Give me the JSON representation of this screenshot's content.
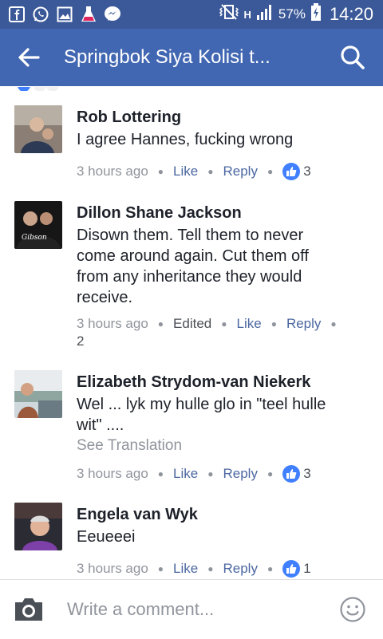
{
  "status_bar": {
    "battery": "57%",
    "time": "14:20",
    "network": "H"
  },
  "app_bar": {
    "title": "Springbok Siya Kolisi t..."
  },
  "comments": [
    {
      "author": "Rob Lottering",
      "lines": [
        "I agree Hannes, fucking wrong"
      ],
      "time": "3 hours ago",
      "like_label": "Like",
      "reply_label": "Reply",
      "reactions": "3"
    },
    {
      "author": "Dillon Shane Jackson",
      "lines": [
        "Disown them. Tell them to never",
        "come around again. Cut them off",
        "from any inheritance they would",
        "receive."
      ],
      "time": "3 hours ago",
      "edited_label": "Edited",
      "like_label": "Like",
      "reply_label": "Reply",
      "reactions": "2"
    },
    {
      "author": "Elizabeth Strydom-van Niekerk",
      "lines": [
        "Wel ... lyk my hulle glo in \"teel hulle",
        "wit\" ...."
      ],
      "see_translation": "See Translation",
      "time": "3 hours ago",
      "like_label": "Like",
      "reply_label": "Reply",
      "reactions": "3"
    },
    {
      "author": "Engela van Wyk",
      "lines": [
        "Eeueeei"
      ],
      "time": "3 hours ago",
      "like_label": "Like",
      "reply_label": "Reply",
      "reactions": "1"
    }
  ],
  "composer": {
    "placeholder": "Write a comment..."
  },
  "colors": {
    "status_bar": "#3b5998",
    "app_bar": "#4267b2",
    "like_bubble": "#4080ff"
  }
}
